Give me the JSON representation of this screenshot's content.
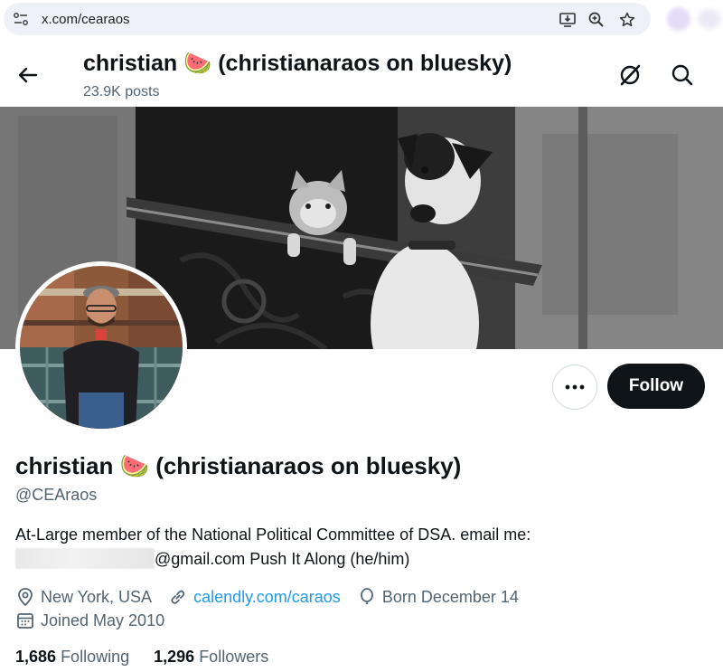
{
  "browser": {
    "url": "x.com/cearaos",
    "icons": [
      "site-info-icon",
      "install-app-icon",
      "zoom-icon",
      "bookmark-star-icon"
    ]
  },
  "header": {
    "name": "christian 🍉 (christianaraos on bluesky)",
    "posts": "23.9K posts",
    "icons": [
      "back-arrow-icon",
      "grok-icon",
      "search-icon"
    ]
  },
  "profile": {
    "display_name": "christian 🍉 (christianaraos on bluesky)",
    "handle": "@CEAraos",
    "bio_line1": "At-Large member of the National Political Committee of DSA. email me:",
    "bio_line2": "@gmail.com Push It Along (he/him)",
    "location": "New York, USA",
    "website": "calendly.com/caraos",
    "birthday": "Born December 14",
    "joined": "Joined May 2010",
    "following_count": "1,686",
    "following_label": "Following",
    "followers_count": "1,296",
    "followers_label": "Followers"
  },
  "actions": {
    "more_icon": "more-dots-icon",
    "follow_label": "Follow"
  },
  "colors": {
    "accent": "#1d9bf0",
    "text": "#0f1419",
    "secondary": "#536471",
    "follow_bg": "#0f1419"
  }
}
